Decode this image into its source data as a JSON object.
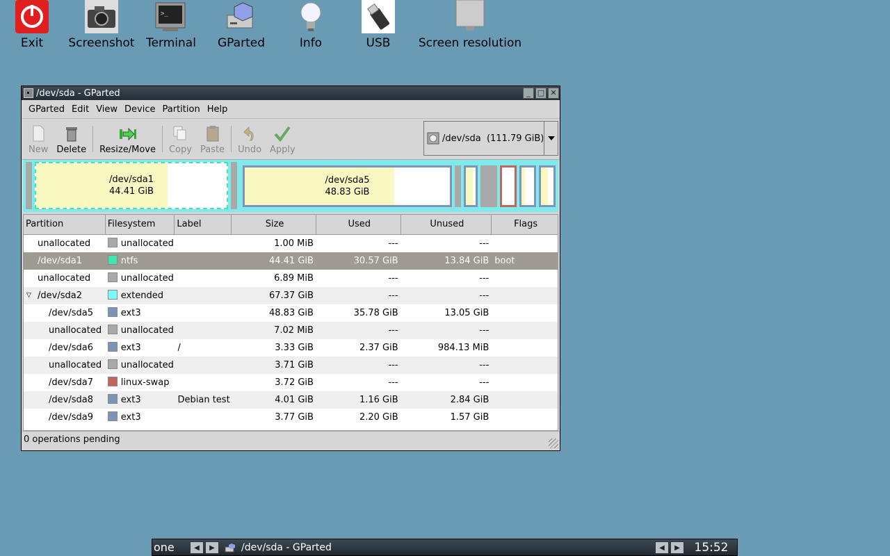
{
  "desktop": {
    "icons": [
      {
        "name": "exit",
        "label": "Exit"
      },
      {
        "name": "screenshot",
        "label": "Screenshot"
      },
      {
        "name": "terminal",
        "label": "Terminal"
      },
      {
        "name": "gparted",
        "label": "GParted"
      },
      {
        "name": "info",
        "label": "Info"
      },
      {
        "name": "usb",
        "label": "USB"
      },
      {
        "name": "screen-resolution",
        "label": "Screen resolution"
      }
    ]
  },
  "window": {
    "title": "/dev/sda - GParted",
    "menus": [
      "GParted",
      "Edit",
      "View",
      "Device",
      "Partition",
      "Help"
    ],
    "toolbar": {
      "new": "New",
      "delete": "Delete",
      "resize_move": "Resize/Move",
      "copy": "Copy",
      "paste": "Paste",
      "undo": "Undo",
      "apply": "Apply"
    },
    "device_selector": "/dev/sda  (111.79 GiB)",
    "map": {
      "sda1": {
        "name": "/dev/sda1",
        "size": "44.41 GiB",
        "used_fraction": 0.69
      },
      "sda5": {
        "name": "/dev/sda5",
        "size": "48.83 GiB",
        "used_fraction": 0.73
      }
    },
    "columns": [
      "Partition",
      "Filesystem",
      "Label",
      "Size",
      "Used",
      "Unused",
      "Flags"
    ],
    "rows": [
      {
        "partition": "unallocated",
        "fs": "unallocated",
        "label": "",
        "size": "1.00 MiB",
        "used": "---",
        "unused": "---",
        "flags": ""
      },
      {
        "partition": "/dev/sda1",
        "fs": "ntfs",
        "label": "",
        "size": "44.41 GiB",
        "used": "30.57 GiB",
        "unused": "13.84 GiB",
        "flags": "boot"
      },
      {
        "partition": "unallocated",
        "fs": "unallocated",
        "label": "",
        "size": "6.89 MiB",
        "used": "---",
        "unused": "---",
        "flags": ""
      },
      {
        "partition": "/dev/sda2",
        "fs": "extended",
        "label": "",
        "size": "67.37 GiB",
        "used": "---",
        "unused": "---",
        "flags": ""
      },
      {
        "partition": "/dev/sda5",
        "fs": "ext3",
        "label": "",
        "size": "48.83 GiB",
        "used": "35.78 GiB",
        "unused": "13.05 GiB",
        "flags": ""
      },
      {
        "partition": "unallocated",
        "fs": "unallocated",
        "label": "",
        "size": "7.02 MiB",
        "used": "---",
        "unused": "---",
        "flags": ""
      },
      {
        "partition": "/dev/sda6",
        "fs": "ext3",
        "label": "/",
        "size": "3.33 GiB",
        "used": "2.37 GiB",
        "unused": "984.13 MiB",
        "flags": ""
      },
      {
        "partition": "unallocated",
        "fs": "unallocated",
        "label": "",
        "size": "3.71 GiB",
        "used": "---",
        "unused": "---",
        "flags": ""
      },
      {
        "partition": "/dev/sda7",
        "fs": "linux-swap",
        "label": "",
        "size": "3.72 GiB",
        "used": "---",
        "unused": "---",
        "flags": ""
      },
      {
        "partition": "/dev/sda8",
        "fs": "ext3",
        "label": "Debian test",
        "size": "4.01 GiB",
        "used": "1.16 GiB",
        "unused": "2.84 GiB",
        "flags": ""
      },
      {
        "partition": "/dev/sda9",
        "fs": "ext3",
        "label": "",
        "size": "3.77 GiB",
        "used": "2.20 GiB",
        "unused": "1.57 GiB",
        "flags": ""
      }
    ],
    "status": "0 operations pending"
  },
  "fs_colors": {
    "unallocated": "#a9a9a9",
    "ntfs": "#42e5ac",
    "extended": "#7dfcfe",
    "ext3": "#7b94b8",
    "linux-swap": "#c1665a"
  },
  "taskbar": {
    "desktop_name": "one",
    "task_title": "/dev/sda - GParted",
    "clock": "15:52"
  }
}
